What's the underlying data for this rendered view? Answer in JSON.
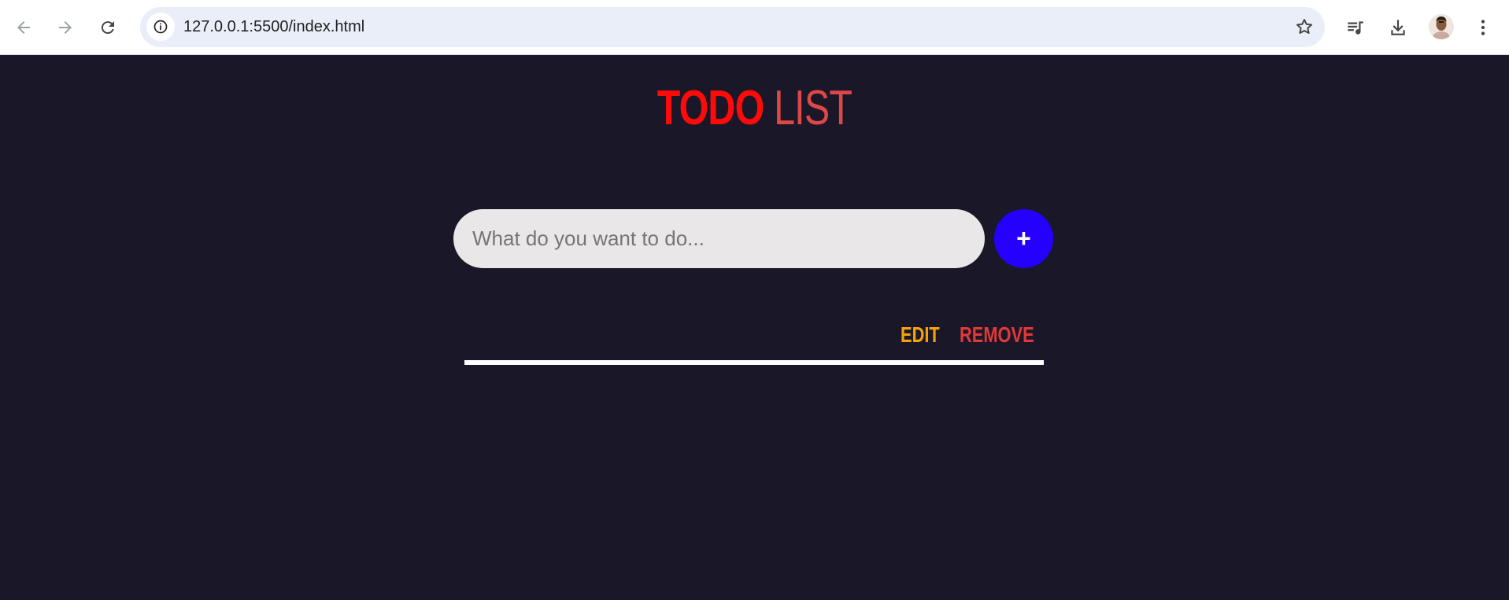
{
  "browser": {
    "url": "127.0.0.1:5500/index.html",
    "icons": {
      "back": "back-arrow-icon",
      "forward": "forward-arrow-icon",
      "reload": "reload-icon",
      "site_info": "info-icon",
      "bookmark": "star-icon",
      "media": "media-queue-icon",
      "download": "download-icon",
      "profile": "avatar",
      "menu": "kebab-menu-icon"
    }
  },
  "app": {
    "title_part1": "TODO",
    "title_part2": "LIST",
    "input_placeholder": "What do you want to do...",
    "add_label": "+",
    "todo_items": [
      {
        "text": "",
        "edit_label": "EDIT",
        "remove_label": "REMOVE"
      }
    ],
    "colors": {
      "background": "#1a1828",
      "title_todo": "#ff0a0a",
      "title_list": "#e04747",
      "add_button": "#2500ff",
      "edit": "#f5a30b",
      "remove": "#e33838",
      "input_bg": "#e9e7e7"
    }
  }
}
